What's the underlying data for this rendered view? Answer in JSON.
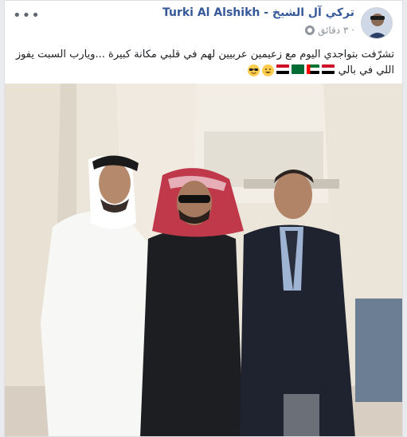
{
  "post": {
    "author_name": "Turki Al Alshikh - تركي آل الشيخ",
    "timestamp": "٣ دقائق ·",
    "body_text": "تشرّفت بتواجدي اليوم مع زعيمين عربيين لهم في قلبي مكانة كبيرة ...ويارب السبت يفوز اللي في بالي",
    "more_label": "•••"
  },
  "icons": {
    "more": "more-options-icon",
    "privacy": "globe-icon",
    "emojis": [
      "sunglasses-face",
      "grinning-face",
      "egypt-flag",
      "saudi-flag",
      "uae-flag",
      "egypt-flag"
    ]
  },
  "colors": {
    "author_link": "#365899",
    "meta_text": "#90949c",
    "body_text": "#1c1e21",
    "background": "#e9ebee"
  }
}
